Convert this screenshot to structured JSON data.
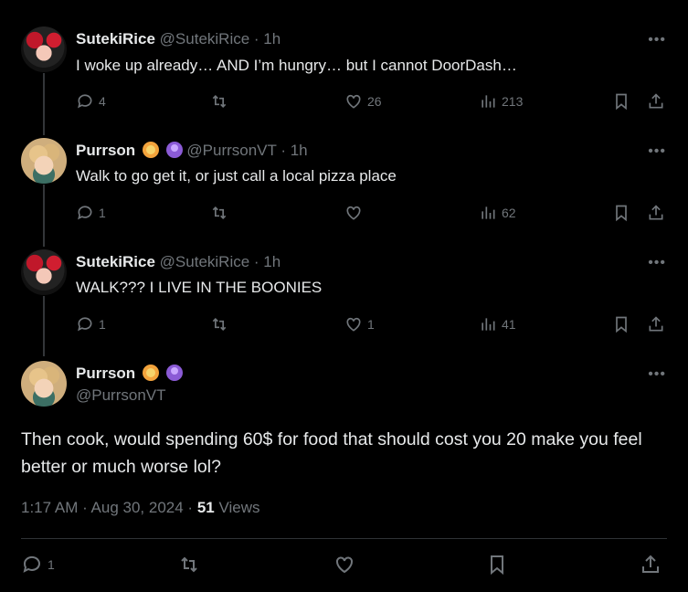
{
  "tweets": [
    {
      "name": "SutekiRice",
      "handle": "@SutekiRice",
      "time": "· 1h",
      "text": "I woke up already… AND I’m hungry… but I cannot DoorDash…",
      "replies": "4",
      "retweets": "",
      "likes": "26",
      "views": "213"
    },
    {
      "name": "Purrson",
      "handle": "@PurrsonVT",
      "time": "· 1h",
      "text": "Walk to go get it, or just call a local pizza place",
      "replies": "1",
      "retweets": "",
      "likes": "",
      "views": "62"
    },
    {
      "name": "SutekiRice",
      "handle": "@SutekiRice",
      "time": "· 1h",
      "text": "WALK??? I LIVE IN THE BOONIES",
      "replies": "1",
      "retweets": "",
      "likes": "1",
      "views": "41"
    }
  ],
  "main_tweet": {
    "name": "Purrson",
    "handle": "@PurrsonVT",
    "text": "Then cook, would spending 60$ for food that should cost you 20 make you feel better or much worse lol?",
    "time": "1:17 AM · Aug 30, 2024 ·",
    "views_count": "51",
    "views_label": "Views",
    "replies": "1"
  },
  "more_label": "•••",
  "colors": {
    "background": "#000000",
    "text": "#e7e9ea",
    "muted": "#71767b",
    "divider": "#2f3336"
  }
}
